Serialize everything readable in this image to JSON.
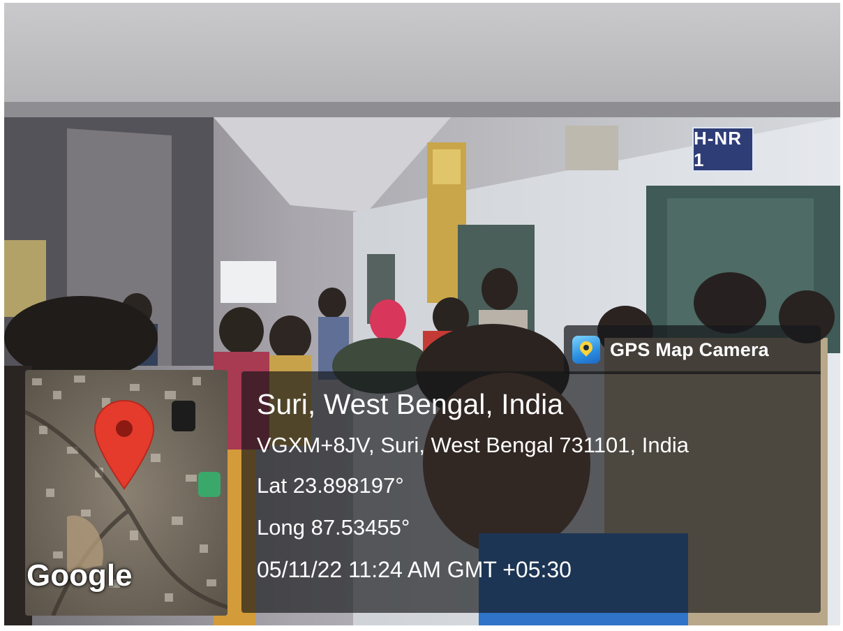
{
  "overlay": {
    "app_name": "GPS Map Camera",
    "app_icon": "gps-map-camera-app-icon",
    "title": "Suri, West Bengal, India",
    "address": "VGXM+8JV, Suri, West Bengal 731101, India",
    "latitude": "Lat 23.898197°",
    "longitude": "Long 87.53455°",
    "timestamp": "05/11/22 11:24 AM GMT +05:30",
    "map": {
      "provider": "Google",
      "pin_icon": "map-pin-icon",
      "pin_color": "#e53b2c"
    }
  },
  "scene": {
    "room_sign": "H-NR 1"
  }
}
